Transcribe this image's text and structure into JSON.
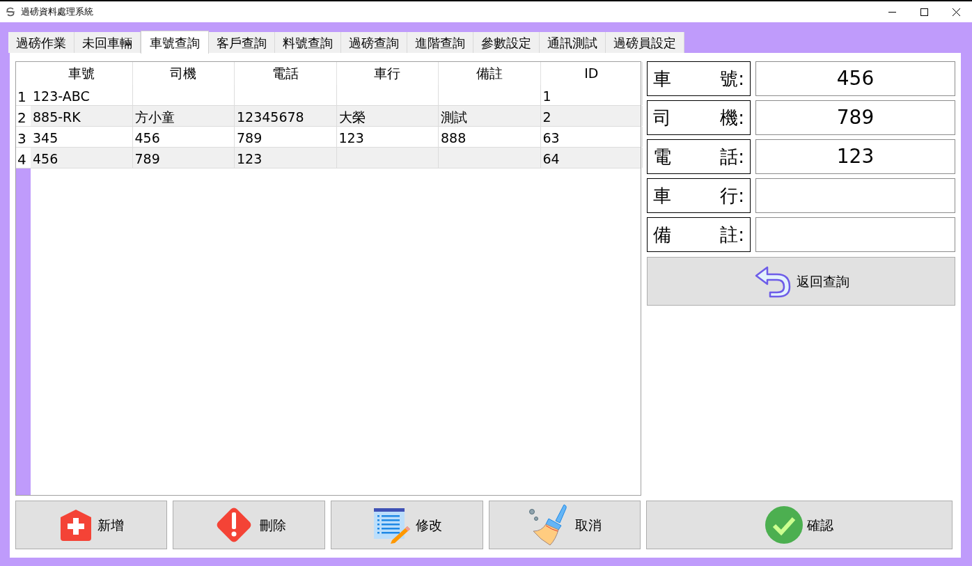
{
  "window": {
    "title": "過磅資料處理系統"
  },
  "tabs": [
    {
      "label": "過磅作業",
      "selected": false
    },
    {
      "label": "未回車輛",
      "selected": false
    },
    {
      "label": "車號查詢",
      "selected": true
    },
    {
      "label": "客戶查詢",
      "selected": false
    },
    {
      "label": "料號查詢",
      "selected": false
    },
    {
      "label": "過磅查詢",
      "selected": false
    },
    {
      "label": "進階查詢",
      "selected": false
    },
    {
      "label": "參數設定",
      "selected": false
    },
    {
      "label": "通訊測試",
      "selected": false
    },
    {
      "label": "過磅員設定",
      "selected": false
    }
  ],
  "table": {
    "columns": [
      "車號",
      "司機",
      "電話",
      "車行",
      "備註",
      "ID"
    ],
    "rows": [
      {
        "number": "1",
        "cells": [
          "123-ABC",
          null,
          null,
          null,
          null,
          "1"
        ]
      },
      {
        "number": "2",
        "cells": [
          "885-RK",
          "方小童",
          "12345678",
          "大榮",
          "測試",
          "2"
        ]
      },
      {
        "number": "3",
        "cells": [
          "345",
          "456",
          "789",
          "123",
          "888",
          "63"
        ]
      },
      {
        "number": "4",
        "cells": [
          "456",
          "789",
          "123",
          null,
          null,
          "64"
        ]
      }
    ]
  },
  "form": {
    "fields": [
      {
        "label": [
          "車",
          "號:"
        ],
        "value": "456"
      },
      {
        "label": [
          "司",
          "機:"
        ],
        "value": "789"
      },
      {
        "label": [
          "電",
          "話:"
        ],
        "value": "123"
      },
      {
        "label": [
          "車",
          "行:"
        ]
      },
      {
        "label": [
          "備",
          "註:"
        ]
      }
    ],
    "back_button": "返回查詢"
  },
  "buttons": [
    {
      "kind": "add",
      "label": "新增"
    },
    {
      "kind": "delete",
      "label": "刪除"
    },
    {
      "kind": "edit",
      "label": "修改"
    },
    {
      "kind": "cancel",
      "label": "取消"
    },
    {
      "kind": "confirm",
      "label": "確認"
    }
  ]
}
